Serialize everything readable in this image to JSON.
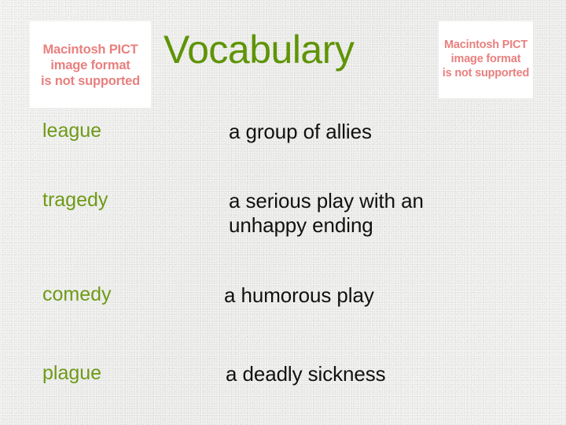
{
  "slide": {
    "title": "Vocabulary",
    "title_color": "#5f9406",
    "background_color": "#e9e9e7",
    "term_color": "#6f9a17",
    "definition_color": "#111111"
  },
  "placeholders": {
    "color": "#e8807f",
    "left": {
      "lines": [
        "Macintosh PICT",
        "image format",
        "is not supported"
      ]
    },
    "right": {
      "lines": [
        "Macintosh PICT",
        "image format",
        "is not supported"
      ]
    }
  },
  "vocabulary": {
    "rows": [
      {
        "term": "league",
        "definition_lines": [
          "a group of allies"
        ]
      },
      {
        "term": "tragedy",
        "definition_lines": [
          "a serious play with an",
          "unhappy ending"
        ]
      },
      {
        "term": "comedy",
        "definition_lines": [
          "a humorous play"
        ]
      },
      {
        "term": "plague",
        "definition_lines": [
          "a deadly sickness"
        ]
      }
    ]
  }
}
